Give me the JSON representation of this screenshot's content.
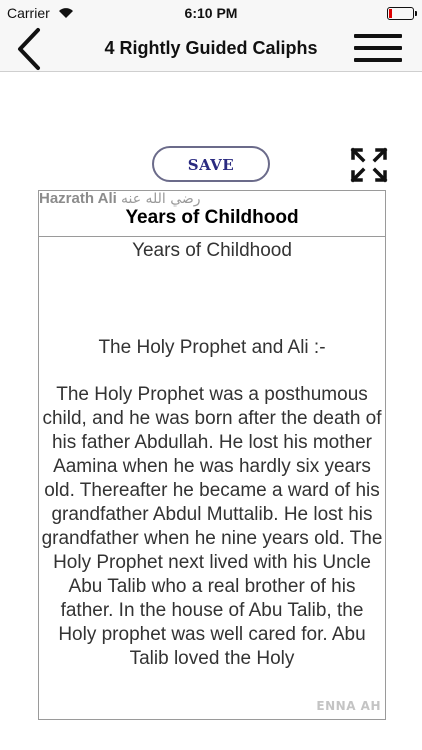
{
  "status_bar": {
    "carrier": "Carrier",
    "time": "6:10 PM"
  },
  "nav": {
    "title": "4 Rightly Guided Caliphs",
    "back_icon": "chevron-left-icon",
    "menu_icon": "hamburger-menu-icon"
  },
  "toolbar": {
    "save_label": "SAVE",
    "expand_icon": "fullscreen-expand-icon"
  },
  "article": {
    "watermark_name": "Hazrath Ali",
    "watermark_arabic": "رضي الله عنه",
    "heading": "Years of Childhood",
    "subtitle": "Years of Childhood",
    "section_title": "The Holy Prophet and Ali :-",
    "paragraph": "The Holy Prophet was a posthumous child, and he was born after the death of his father Abdullah. He lost his mother Aamina when he was hardly six years old. Thereafter he became a ward of his grandfather Abdul Muttalib. He lost his grandfather when he nine years old. The Holy Prophet next lived with his Uncle Abu Talib who a real brother of his father. In the house of Abu Talib, the Holy prophet was well cared for. Abu Talib loved the Holy",
    "corner_brand": "ENNA AH"
  },
  "colors": {
    "save_text": "#2a2a80",
    "save_border": "#6b6b8a",
    "battery_level": "#dd0000"
  }
}
